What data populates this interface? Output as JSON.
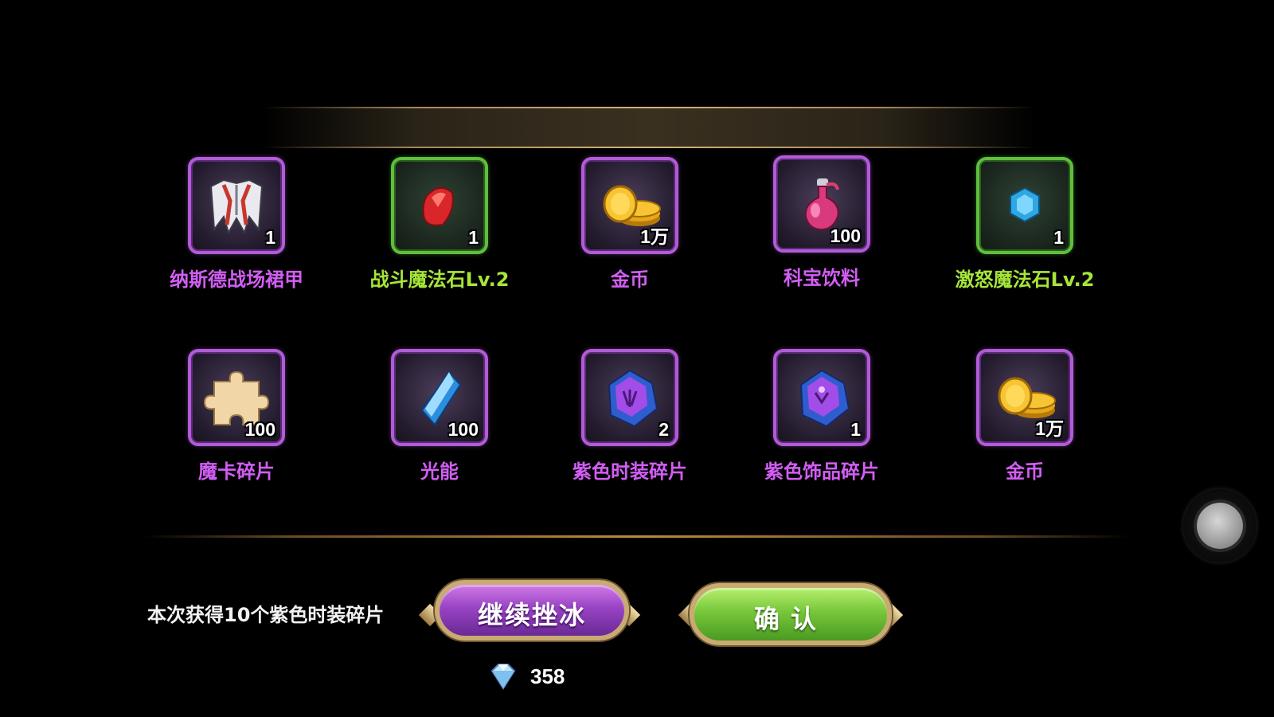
{
  "rewards": [
    {
      "name": "纳斯德战场裙甲",
      "qty": "1",
      "rarity": "purple",
      "icon": "armor-skirt-icon"
    },
    {
      "name": "战斗魔法石Lv.2",
      "qty": "1",
      "rarity": "green",
      "icon": "red-gem-icon"
    },
    {
      "name": "金币",
      "qty": "1万",
      "rarity": "purple",
      "icon": "gold-coins-icon"
    },
    {
      "name": "科宝饮料",
      "qty": "100",
      "rarity": "purple",
      "icon": "potion-icon"
    },
    {
      "name": "激怒魔法石Lv.2",
      "qty": "1",
      "rarity": "green",
      "icon": "blue-gem-icon"
    },
    {
      "name": "魔卡碎片",
      "qty": "100",
      "rarity": "purple",
      "icon": "puzzle-piece-icon"
    },
    {
      "name": "光能",
      "qty": "100",
      "rarity": "purple",
      "icon": "light-crystal-icon"
    },
    {
      "name": "紫色时装碎片",
      "qty": "2",
      "rarity": "purple",
      "icon": "costume-shard-icon"
    },
    {
      "name": "紫色饰品碎片",
      "qty": "1",
      "rarity": "purple",
      "icon": "accessory-shard-icon"
    },
    {
      "name": "金币",
      "qty": "1万",
      "rarity": "purple",
      "icon": "gold-coins-icon"
    }
  ],
  "footer": {
    "hint": "本次获得10个紫色时装碎片",
    "continue_label": "继续挫冰",
    "confirm_label": "确认",
    "cost_amount": "358",
    "cost_icon": "diamond-icon"
  },
  "colors": {
    "purple_rarity": "#d25ef5",
    "green_rarity": "#a6e63a"
  }
}
